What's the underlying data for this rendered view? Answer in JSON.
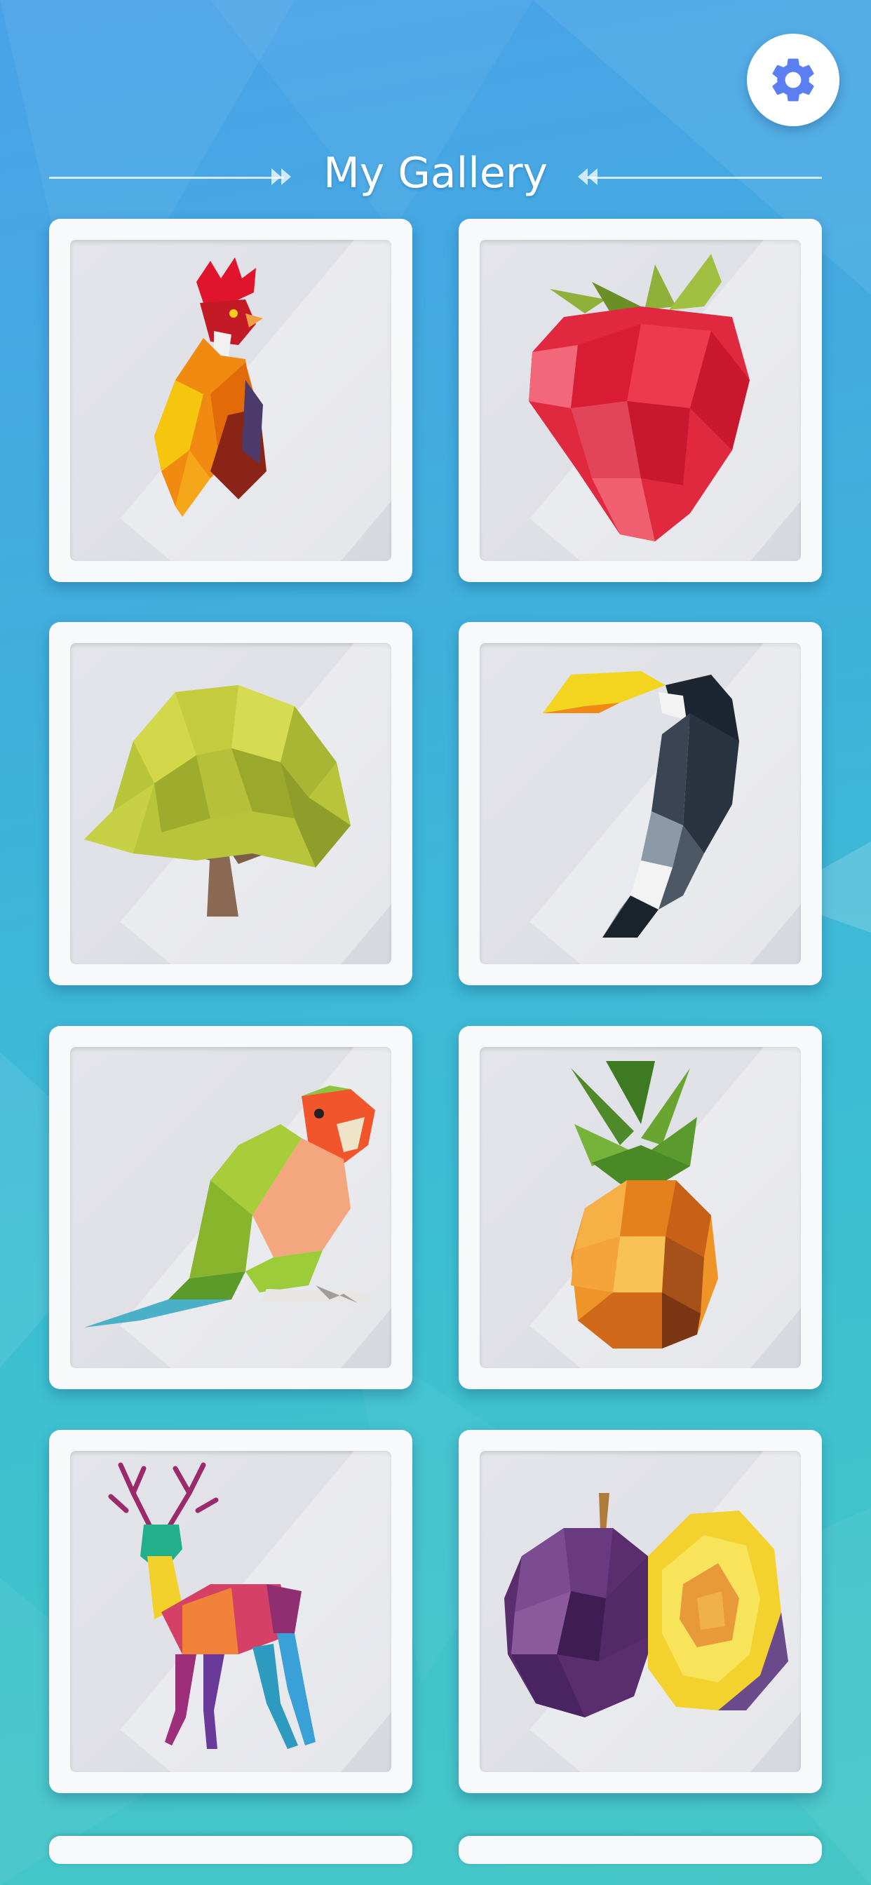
{
  "header": {
    "title": "My Gallery"
  },
  "settings": {
    "icon": "gear-icon",
    "color": "#5b7ff0"
  },
  "gallery": {
    "items": [
      {
        "name": "rooster"
      },
      {
        "name": "strawberry"
      },
      {
        "name": "tree"
      },
      {
        "name": "toucan"
      },
      {
        "name": "parrot"
      },
      {
        "name": "pineapple"
      },
      {
        "name": "deer"
      },
      {
        "name": "plum"
      }
    ]
  },
  "colors": {
    "background_top": "#4aa2e8",
    "background_bottom": "#46c7c6",
    "card": "#f8f9fb"
  }
}
